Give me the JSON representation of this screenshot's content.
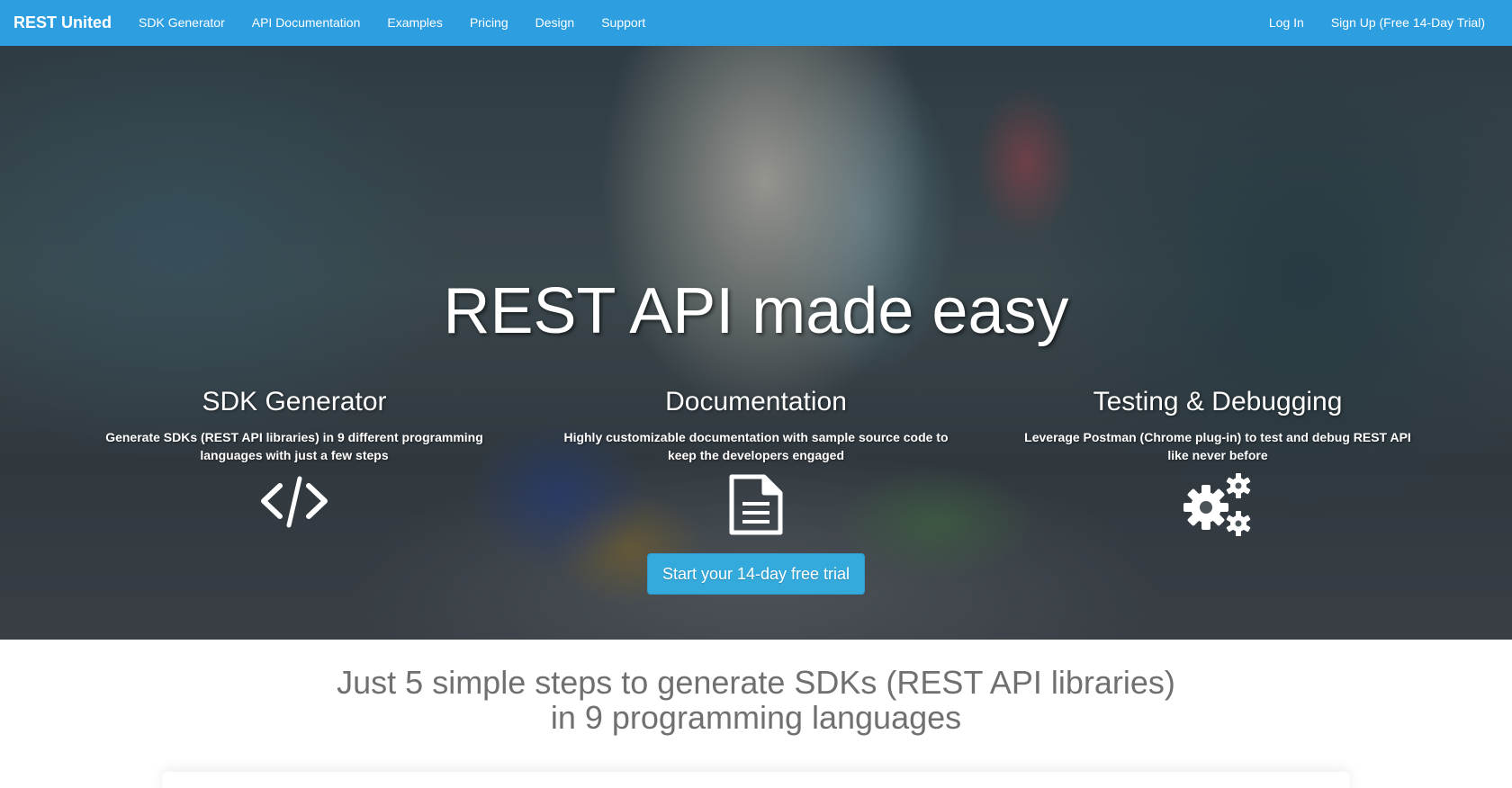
{
  "navbar": {
    "brand": "REST United",
    "left_links": [
      {
        "label": "SDK Generator"
      },
      {
        "label": "API Documentation"
      },
      {
        "label": "Examples"
      },
      {
        "label": "Pricing"
      },
      {
        "label": "Design"
      },
      {
        "label": "Support"
      }
    ],
    "right_links": [
      {
        "label": "Log In"
      },
      {
        "label": "Sign Up (Free 14-Day Trial)"
      }
    ],
    "background_color": "#2d9ee0"
  },
  "hero": {
    "title": "REST API made easy",
    "features": [
      {
        "title": "SDK Generator",
        "description": "Generate SDKs (REST API libraries) in 9 different programming languages with just a few steps",
        "icon": "code-icon"
      },
      {
        "title": "Documentation",
        "description": "Highly customizable documentation with sample source code to keep the developers engaged",
        "icon": "document-icon"
      },
      {
        "title": "Testing & Debugging",
        "description": "Leverage Postman (Chrome plug-in) to test and debug REST API like never before",
        "icon": "gears-icon"
      }
    ],
    "cta_label": "Start your 14-day free trial",
    "cta_color": "#34aadc"
  },
  "steps": {
    "heading_line1": "Just 5 simple steps to generate SDKs (REST API libraries)",
    "heading_line2": "in 9 programming languages"
  }
}
